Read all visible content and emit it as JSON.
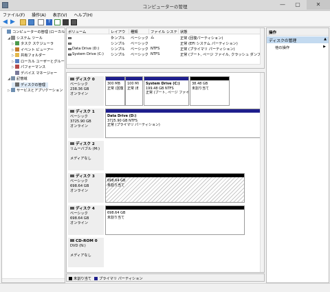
{
  "window": {
    "title": "コンピューターの管理",
    "min": "—",
    "max": "▢",
    "close": "✕"
  },
  "menu": [
    "ファイル(F)",
    "操作(A)",
    "表示(V)",
    "ヘルプ(H)"
  ],
  "tree": [
    {
      "label": "コンピューターの管理 (ローカル)",
      "icon": "computer-icon",
      "indent": 0,
      "arrow": ""
    },
    {
      "label": "システム ツール",
      "icon": "tools-icon",
      "indent": 1,
      "arrow": "◢"
    },
    {
      "label": "タスク スケジューラ",
      "icon": "clock-icon",
      "indent": 2,
      "arrow": "▷"
    },
    {
      "label": "イベント ビューアー",
      "icon": "event-icon",
      "indent": 2,
      "arrow": "▷"
    },
    {
      "label": "共有フォルダー",
      "icon": "folder-icon",
      "indent": 2,
      "arrow": "▷"
    },
    {
      "label": "ローカル ユーザーとグループ",
      "icon": "users-icon",
      "indent": 2,
      "arrow": "▷"
    },
    {
      "label": "パフォーマンス",
      "icon": "performance-icon",
      "indent": 2,
      "arrow": "▷"
    },
    {
      "label": "デバイス マネージャー",
      "icon": "device-icon",
      "indent": 2,
      "arrow": ""
    },
    {
      "label": "記憶域",
      "icon": "storage-icon",
      "indent": 1,
      "arrow": "◢"
    },
    {
      "label": "ディスクの管理",
      "icon": "disk-icon",
      "indent": 2,
      "arrow": ""
    },
    {
      "label": "サービスとアプリケーション",
      "icon": "services-icon",
      "indent": 1,
      "arrow": "▷"
    }
  ],
  "list": {
    "headers": [
      "ボリューム",
      "レイアウト",
      "種類",
      "ファイル システム",
      "状態"
    ],
    "rows": [
      {
        "volume": "",
        "layout": "シンプル",
        "type": "ベーシック",
        "fs": "",
        "status": "正常 (回復パーティション)"
      },
      {
        "volume": "",
        "layout": "シンプル",
        "type": "ベーシック",
        "fs": "",
        "status": "正常 (EFI システム パーティション)"
      },
      {
        "volume": "Data Drive (D:)",
        "layout": "シンプル",
        "type": "ベーシック",
        "fs": "NTFS",
        "status": "正常 (プライマリ パーティション)"
      },
      {
        "volume": "System Drive (C:)",
        "layout": "シンプル",
        "type": "ベーシック",
        "fs": "NTFS",
        "status": "正常 (ブート, ページ ファイル, クラッシュ ダンプ, プライ"
      }
    ]
  },
  "disks": [
    {
      "name": "ディスク 0",
      "kind": "ベーシック",
      "size": "238.36 GB",
      "state": "オンライン",
      "parts": [
        {
          "l1": "",
          "l2": "300 MB",
          "l3": "正常 (回復",
          "bar": "#1e1e8c",
          "hatch": false
        },
        {
          "l1": "",
          "l2": "100 MI",
          "l3": "正常 (E",
          "bar": "#1e1e8c",
          "hatch": false
        },
        {
          "l1": "System Drive (C:)",
          "l2": "199.48 GB NTFS",
          "l3": "正常 (ブート, ページ ファイ",
          "bar": "#1e1e8c",
          "hatch": false
        },
        {
          "l1": "",
          "l2": "38.48 GB",
          "l3": "未割り当て",
          "bar": "#000000",
          "hatch": false
        }
      ]
    },
    {
      "name": "ディスク 1",
      "kind": "ベーシック",
      "size": "3725.90 GB",
      "state": "オンライン",
      "parts": [
        {
          "l1": "Data Drive (D:)",
          "l2": "3725.90 GB NTFS",
          "l3": "正常 (プライマリ パーティション)",
          "bar": "#1e1e8c",
          "hatch": false
        }
      ]
    },
    {
      "name": "ディスク 2",
      "kind": "リムーバブル (M:)",
      "size": "",
      "state": "メディアなし",
      "parts": []
    },
    {
      "name": "ディスク 3",
      "kind": "ベーシック",
      "size": "698.64 GB",
      "state": "オンライン",
      "parts": [
        {
          "l1": "",
          "l2": "698.64 GB",
          "l3": "未割り当て",
          "bar": "#000000",
          "hatch": true
        }
      ]
    },
    {
      "name": "ディスク 4",
      "kind": "ベーシック",
      "size": "698.64 GB",
      "state": "オンライン",
      "parts": [
        {
          "l1": "",
          "l2": "698.64 GB",
          "l3": "未割り当て",
          "bar": "#000000",
          "hatch": false
        }
      ]
    },
    {
      "name": "CD-ROM 0",
      "kind": "DVD (N:)",
      "size": "",
      "state": "メディアなし",
      "parts": []
    }
  ],
  "legend": [
    {
      "label": "未割り当て",
      "color": "#000000"
    },
    {
      "label": "プライマリ パーティション",
      "color": "#1e1e8c"
    }
  ],
  "actions": {
    "header": "操作",
    "section": "ディスクの管理",
    "item": "他の操作"
  }
}
